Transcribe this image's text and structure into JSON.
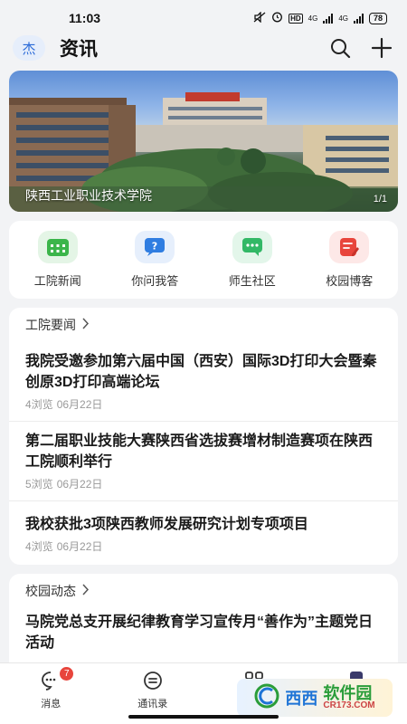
{
  "status": {
    "time": "11:03",
    "network": "4G",
    "hd": "HD",
    "battery": "78"
  },
  "header": {
    "avatar_char": "杰",
    "title": "资讯"
  },
  "banner": {
    "caption": "陕西工业职业技术学院",
    "indicator": "1/1"
  },
  "quick_links": [
    {
      "label": "工院新闻",
      "color": "#3bb54a"
    },
    {
      "label": "你问我答",
      "color": "#2f7de1"
    },
    {
      "label": "师生社区",
      "color": "#32b866"
    },
    {
      "label": "校园博客",
      "color": "#e8453c"
    }
  ],
  "sections": [
    {
      "title": "工院要闻",
      "items": [
        {
          "title": "我院受邀参加第六届中国（西安）国际3D打印大会暨秦创原3D打印高端论坛",
          "views": "4浏览",
          "date": "06月22日"
        },
        {
          "title": "第二届职业技能大赛陕西省选拔赛增材制造赛项在陕西工院顺利举行",
          "views": "5浏览",
          "date": "06月22日"
        },
        {
          "title": "我校获批3项陕西教师发展研究计划专项项目",
          "views": "4浏览",
          "date": "06月22日"
        }
      ]
    },
    {
      "title": "校园动态",
      "items": [
        {
          "title": "马院党总支开展纪律教育学习宣传月“善作为”主题党日活动",
          "views": "",
          "date": ""
        }
      ]
    }
  ],
  "tabbar": {
    "tabs": [
      {
        "label": "消息",
        "badge": "7"
      },
      {
        "label": "通讯录"
      }
    ]
  },
  "watermark": {
    "part_a": "西西",
    "part_b": "软件园",
    "part_c": "CR173.COM"
  },
  "colors": {
    "accent": "#2a6ad8",
    "badge": "#e8453c"
  }
}
